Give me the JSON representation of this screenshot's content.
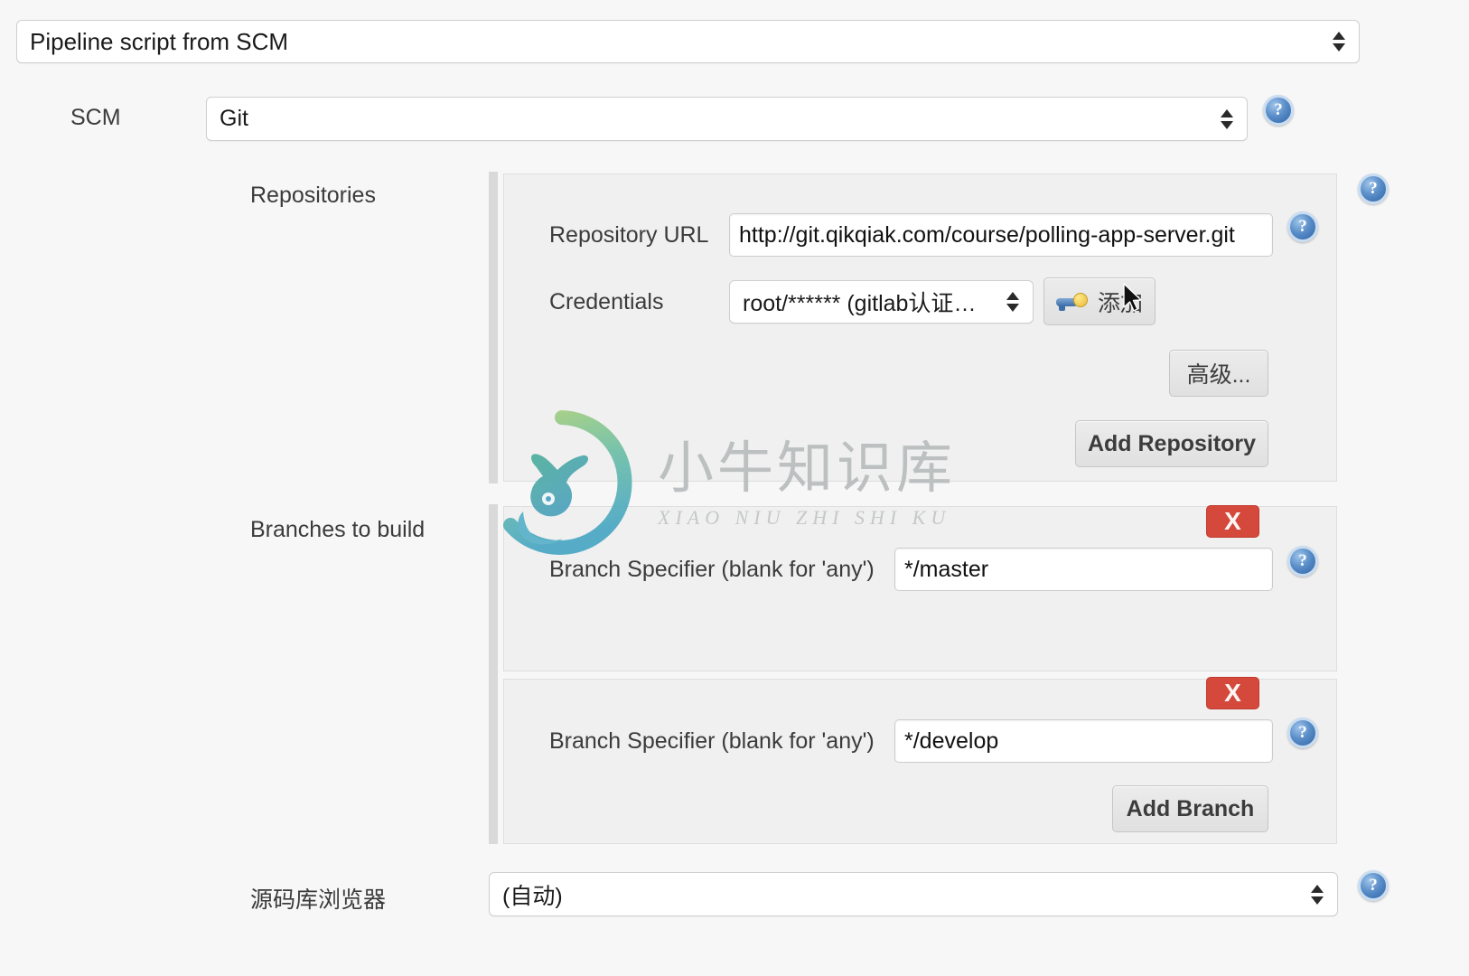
{
  "definition": {
    "selected": "Pipeline script from SCM"
  },
  "scm": {
    "label": "SCM",
    "selected": "Git",
    "help": "?"
  },
  "repositories": {
    "label": "Repositories",
    "help": "?",
    "url": {
      "label": "Repository URL",
      "value": "http://git.qikqiak.com/course/polling-app-server.git",
      "help": "?"
    },
    "credentials": {
      "label": "Credentials",
      "value": "root/****** (gitlab认证信息)",
      "add_button": "添加",
      "add_icon": "key-icon"
    },
    "advanced_button": "高级...",
    "add_repository_button": "Add Repository"
  },
  "branches": {
    "label": "Branches to build",
    "add_branch_button": "Add Branch",
    "delete_label": "X",
    "rows": [
      {
        "label": "Branch Specifier (blank for 'any')",
        "value": "*/master",
        "help": "?"
      },
      {
        "label": "Branch Specifier (blank for 'any')",
        "value": "*/develop",
        "help": "?"
      }
    ]
  },
  "browser": {
    "label": "源码库浏览器",
    "selected": "(自动)",
    "help": "?"
  },
  "watermark": {
    "cn": "小牛知识库",
    "en": "XIAO NIU ZHI SHI KU"
  },
  "colors": {
    "danger": "#d4493c",
    "help_blue": "#2e63a6",
    "panel": "#f0f0f0",
    "page": "#f7f7f7"
  }
}
